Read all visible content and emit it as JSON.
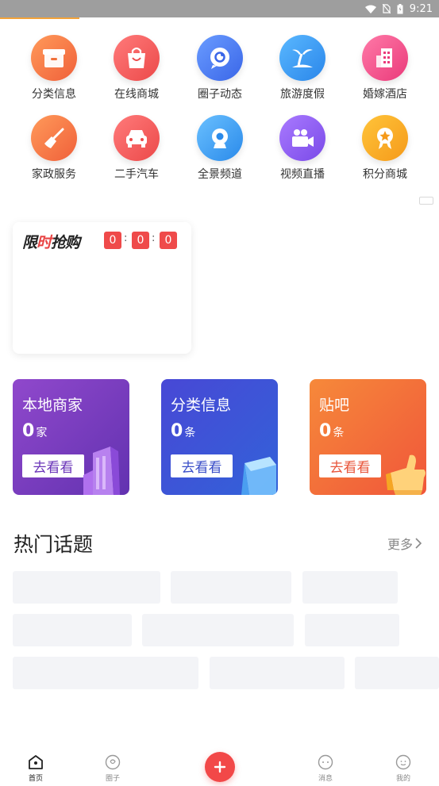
{
  "status_bar": {
    "time": "9:21"
  },
  "categories": [
    {
      "label": "分类信息",
      "icon": "gift-box-icon",
      "color": "#f47a4a"
    },
    {
      "label": "在线商城",
      "icon": "shopping-bag-icon",
      "color": "#f05a5a"
    },
    {
      "label": "圈子动态",
      "icon": "chat-bubble-icon",
      "color": "#4a7cf0"
    },
    {
      "label": "旅游度假",
      "icon": "palm-tree-icon",
      "color": "#3a9ef0"
    },
    {
      "label": "婚嫁酒店",
      "icon": "hotel-building-icon",
      "color": "#f25a8a"
    },
    {
      "label": "家政服务",
      "icon": "broom-icon",
      "color": "#f47a4a"
    },
    {
      "label": "二手汽车",
      "icon": "car-icon",
      "color": "#f05a5a"
    },
    {
      "label": "全景频道",
      "icon": "panorama-camera-icon",
      "color": "#3a9ef0"
    },
    {
      "label": "视频直播",
      "icon": "video-camera-icon",
      "color": "#8a5af0"
    },
    {
      "label": "积分商城",
      "icon": "medal-icon",
      "color": "#f5a623"
    }
  ],
  "flash_sale": {
    "title_left": "限",
    "title_mid": "时",
    "title_right": "抢购",
    "countdown": [
      "0",
      "0",
      "0"
    ],
    "separator": ":"
  },
  "promo_cards": [
    {
      "title": "本地商家",
      "count": "0",
      "unit": "家",
      "button": "去看看",
      "color_from": "#8a42c8",
      "color_to": "#6a34b8",
      "button_color": "#6a34b8"
    },
    {
      "title": "分类信息",
      "count": "0",
      "unit": "条",
      "button": "去看看",
      "color_from": "#4c4fd8",
      "color_to": "#3a5ad8",
      "button_color": "#3a4ec8"
    },
    {
      "title": "贴吧",
      "count": "0",
      "unit": "条",
      "button": "去看看",
      "color_from": "#f5823a",
      "color_to": "#f05a3a",
      "button_color": "#e8553a"
    }
  ],
  "hot_topics": {
    "title": "热门话题",
    "more": "更多"
  },
  "tabbar": {
    "home": "首页",
    "circle": "圈子",
    "messages": "消息",
    "mine": "我的"
  }
}
